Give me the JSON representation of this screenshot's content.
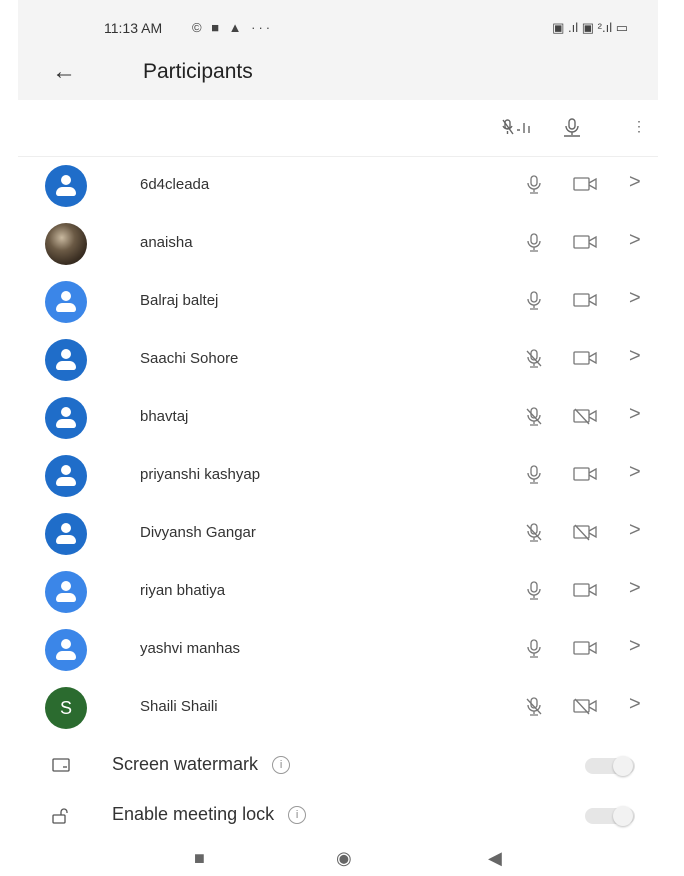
{
  "status_bar": {
    "time": "11:13 AM",
    "left_icons": "© ■ ▲ ···",
    "right_icons": "▣ .ıl ▣ ².ıl ▭"
  },
  "header": {
    "back_icon": "arrow-left",
    "title": "Participants"
  },
  "toolbar": {
    "icons": [
      "mute-all-icon",
      "unmute-all-icon",
      "more-vert-icon"
    ]
  },
  "participants": [
    {
      "name": "6d4cleada",
      "avatar": "default-dark",
      "mic": "on",
      "video": "on"
    },
    {
      "name": "anaisha",
      "avatar": "photo",
      "mic": "on",
      "video": "on"
    },
    {
      "name": "Balraj baltej",
      "avatar": "default-light",
      "mic": "on",
      "video": "on"
    },
    {
      "name": "Saachi Sohore",
      "avatar": "default-dark",
      "mic": "off",
      "video": "on"
    },
    {
      "name": "bhavtaj",
      "avatar": "default-dark",
      "mic": "off",
      "video": "off"
    },
    {
      "name": "priyanshi kashyap",
      "avatar": "default-dark",
      "mic": "on",
      "video": "on"
    },
    {
      "name": "Divyansh Gangar",
      "avatar": "default-dark",
      "mic": "off",
      "video": "off"
    },
    {
      "name": "riyan bhatiya",
      "avatar": "default-light",
      "mic": "on",
      "video": "on"
    },
    {
      "name": "yashvi manhas",
      "avatar": "default-light",
      "mic": "on",
      "video": "on"
    },
    {
      "name": "Shaili Shaili",
      "avatar": "letter",
      "initial": "S",
      "mic": "off",
      "video": "off"
    }
  ],
  "settings": [
    {
      "label": "Screen watermark",
      "enabled": false,
      "icon": "watermark-icon"
    },
    {
      "label": "Enable meeting lock",
      "enabled": false,
      "icon": "lock-icon"
    }
  ],
  "colors": {
    "avatar_dark": "#1f6dc9",
    "avatar_light": "#3b86e8",
    "avatar_green": "#2b6b2f",
    "header_bg": "#f4f4f4"
  },
  "nav_bar": {
    "buttons": [
      "recents",
      "home",
      "back"
    ]
  }
}
